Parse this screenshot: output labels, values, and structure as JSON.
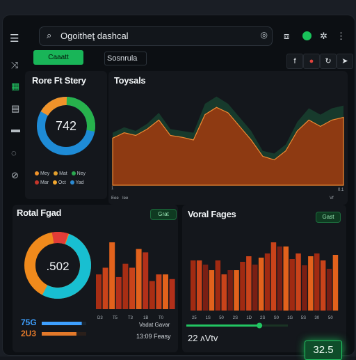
{
  "header": {
    "menu_icon": "menu-icon",
    "search_text": "Ogoitheţ dashcal",
    "search_icon": "search-icon",
    "right_icons": [
      "square-icon",
      "status-dot",
      "gear-icon",
      "more-icon"
    ]
  },
  "toolbar": {
    "create_label": "Caaatt",
    "search_label": "Sosnrula",
    "buttons": [
      "f",
      "●",
      "↻",
      "➤"
    ]
  },
  "sidebar": {
    "icons": [
      "share-icon",
      "grid-icon",
      "document-icon",
      "folder-icon",
      "power-icon",
      "settings-icon"
    ]
  },
  "donut_top": {
    "title": "Rore Ft Stery",
    "center_value": "742",
    "segments": [
      {
        "label": "green",
        "value": 0.28,
        "color": "#27b24c"
      },
      {
        "label": "blue",
        "value": 0.55,
        "color": "#1e8bd6"
      },
      {
        "label": "orange",
        "value": 0.17,
        "color": "#f0932a"
      }
    ],
    "legend": [
      {
        "label": "Mey",
        "color": "#f0932a"
      },
      {
        "label": "Mat",
        "color": "#e3a02d"
      },
      {
        "label": "Ney",
        "color": "#2aa84f"
      },
      {
        "label": "Mar",
        "color": "#c6352a"
      },
      {
        "label": "Oct",
        "color": "#f2a72f"
      },
      {
        "label": "Yad",
        "color": "#2b89d1"
      }
    ]
  },
  "area_chart": {
    "title": "Toysals",
    "tick_left": "1",
    "tick_right": "0.1",
    "x_labels": [
      "Eee",
      "Iee",
      "Vf"
    ]
  },
  "bar_left": {
    "title": "Rotal Fgad",
    "pill": "Grat",
    "center_value": ".502",
    "segments": [
      {
        "label": "cyan",
        "value": 0.52,
        "color": "#18bfd1"
      },
      {
        "label": "orange",
        "value": 0.4,
        "color": "#f08a1c"
      },
      {
        "label": "red",
        "value": 0.08,
        "color": "#e23c37"
      }
    ],
    "ticks": [
      "D3",
      "T5",
      "T3",
      "1B",
      "T0"
    ],
    "stats": [
      {
        "value": "75G",
        "color": "#3ea0ff",
        "bar_fill": 0.9
      },
      {
        "value": "2U3",
        "color": "#e3792a",
        "bar_fill": 0.78
      }
    ],
    "footer_label": "Vadat Gavar",
    "footer_value": "13:09 Feasy"
  },
  "bar_right": {
    "title": "Voral Fages",
    "pill": "Gast",
    "ticks": [
      "25",
      "1S",
      "50",
      "2S",
      "1D",
      "2S",
      "S0",
      "1G",
      "5S",
      "30",
      "50"
    ],
    "slider_value": 0.72,
    "footer": "22 ʌVtv",
    "kpi": "32.5"
  },
  "chart_data": [
    {
      "type": "area",
      "title": "Toysals",
      "series": [
        {
          "values": [
            0.52,
            0.58,
            0.55,
            0.62,
            0.72,
            0.55,
            0.53,
            0.5,
            0.78,
            0.86,
            0.8,
            0.65,
            0.5,
            0.32,
            0.28,
            0.38,
            0.6,
            0.72,
            0.65,
            0.72,
            0.75
          ]
        },
        {
          "values": [
            0.58,
            0.64,
            0.6,
            0.68,
            0.8,
            0.62,
            0.6,
            0.58,
            0.9,
            0.98,
            0.9,
            0.75,
            0.6,
            0.38,
            0.35,
            0.45,
            0.7,
            0.85,
            0.78,
            0.85,
            0.88
          ]
        }
      ]
    },
    {
      "type": "bar",
      "values": [
        0.52,
        0.62,
        1.0,
        0.48,
        0.68,
        0.62,
        0.9,
        0.85,
        0.42,
        0.52,
        0.52,
        0.45
      ]
    },
    {
      "type": "bar",
      "values": [
        0.72,
        0.72,
        0.66,
        0.58,
        0.72,
        0.52,
        0.58,
        0.58,
        0.7,
        0.78,
        0.66,
        0.76,
        0.82,
        0.98,
        0.92,
        0.92,
        0.74,
        0.82,
        0.65,
        0.78,
        0.82,
        0.72,
        0.6,
        0.8
      ]
    }
  ]
}
